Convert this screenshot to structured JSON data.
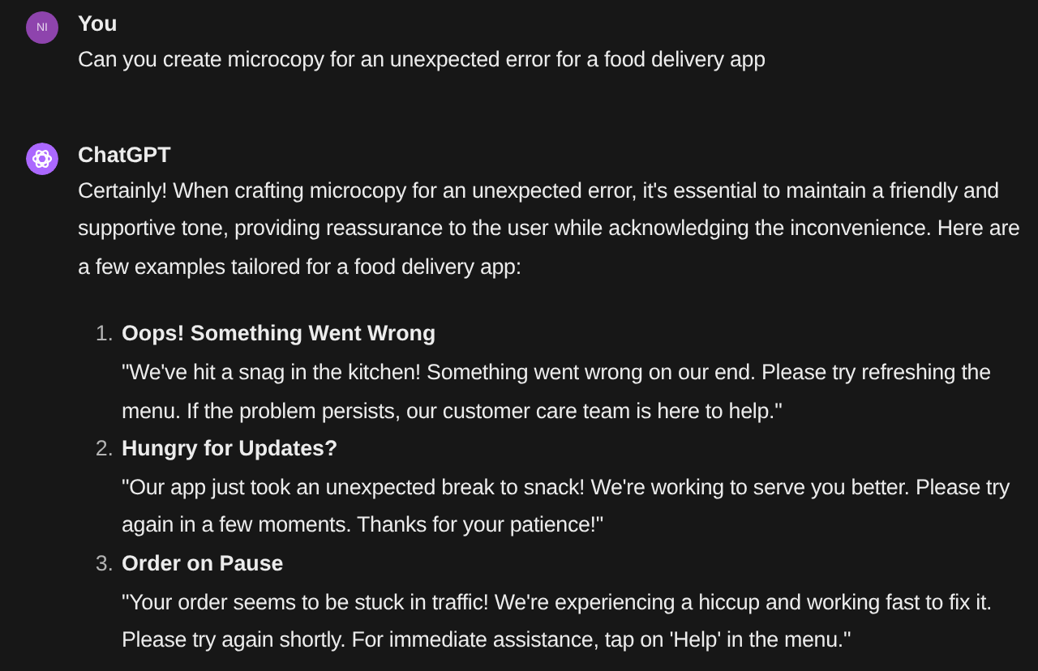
{
  "messages": [
    {
      "author": "You",
      "avatar": {
        "kind": "initials",
        "text": "NI"
      },
      "text": "Can you create microcopy for an unexpected error for a food delivery app"
    },
    {
      "author": "ChatGPT",
      "avatar": {
        "kind": "logo"
      },
      "text": "Certainly! When crafting microcopy for an unexpected error, it's essential to maintain a friendly and supportive tone, providing reassurance to the user while acknowledging the inconvenience. Here are a few examples tailored for a food delivery app:",
      "list": [
        {
          "number": "1.",
          "title": "Oops! Something Went Wrong",
          "text": "\"We've hit a snag in the kitchen! Something went wrong on our end. Please try refreshing the menu. If the problem persists, our customer care team is here to help.\""
        },
        {
          "number": "2.",
          "title": "Hungry for Updates?",
          "text": "\"Our app just took an unexpected break to snack! We're working to serve you better. Please try again in a few moments. Thanks for your patience!\""
        },
        {
          "number": "3.",
          "title": "Order on Pause",
          "text": "\"Your order seems to be stuck in traffic! We're experiencing a hiccup and working fast to fix it. Please try again shortly. For immediate assistance, tap on 'Help' in the menu.\""
        }
      ]
    }
  ]
}
